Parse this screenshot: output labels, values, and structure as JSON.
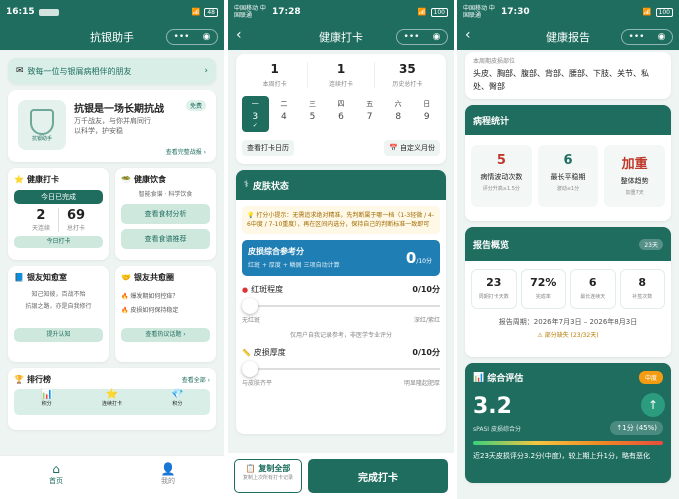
{
  "p1": {
    "status": {
      "time": "16:15",
      "carrier": "中国移动 中国联通",
      "battery": "48"
    },
    "nav_title": "抗银助手",
    "banner": "致每一位与银屑病相伴的朋友",
    "hero": {
      "title": "抗银是一场长期抗战",
      "badge": "免费",
      "l1": "万千战友，与你并肩同行",
      "l2": "以科学，护安稳",
      "shield": "抗银助手",
      "link": "查看完整战报 ›"
    },
    "checkin": {
      "title": "健康打卡",
      "done": "今日已完成",
      "days": "2",
      "days_l": "天连续",
      "count": "69",
      "count_l": "总打卡",
      "btn": "今日打卡"
    },
    "diet": {
      "title": "健康饮食",
      "sub": "智能食谱 · 科学饮食",
      "b1": "查看食材分析",
      "b2": "查看食谱推荐"
    },
    "knowledge": {
      "title": "银友知愈室",
      "t1": "知己知彼，百战不殆",
      "t2": "抗银之路，亦是自我修行",
      "btn": "提升认知"
    },
    "community": {
      "title": "银友共愈圈",
      "i1": "爆发期如何控痒？",
      "i2": "皮损如何保持稳定",
      "btn": "查看热议话题 ›"
    },
    "rank": {
      "title": "排行榜",
      "link": "查看全部 ›",
      "tabs": [
        "积分",
        "连续打卡",
        "积分"
      ]
    },
    "tabbar": {
      "home": "首页",
      "me": "我的"
    }
  },
  "p2": {
    "status": {
      "time": "17:28",
      "carrier": "中国移动 中国联通",
      "battery": "100"
    },
    "nav_title": "健康打卡",
    "stats": [
      {
        "v": "1",
        "l": "本周打卡"
      },
      {
        "v": "1",
        "l": "连续打卡"
      },
      {
        "v": "35",
        "l": "历史总打卡"
      }
    ],
    "week": [
      {
        "d": "一",
        "n": "3",
        "sel": true
      },
      {
        "d": "二",
        "n": "4"
      },
      {
        "d": "三",
        "n": "5"
      },
      {
        "d": "四",
        "n": "6"
      },
      {
        "d": "五",
        "n": "7"
      },
      {
        "d": "六",
        "n": "8"
      },
      {
        "d": "日",
        "n": "9"
      }
    ],
    "cal_btn": "查看打卡日历",
    "cycle_btn": "自定义月份",
    "skin_title": "皮肤状态",
    "tip": "打分小提示：无需追求绝对精准，先判断属于哪一档（1-3轻微 / 4-6中度 / 7-10重度），再在区间内选分，保持自己的判断标准一致即可",
    "score": {
      "title": "皮损综合参考分",
      "sub": "红斑 + 厚度 + 鳞屑 三项自动计算",
      "v": "0",
      "u": "/10分"
    },
    "s1": {
      "t": "红斑程度",
      "v": "0/10分",
      "lo": "无红斑",
      "hi": "深红/紫红"
    },
    "note": "仅用户自我记录参考，非医学专业评分",
    "s2": {
      "t": "皮损厚度",
      "v": "0/10分",
      "lo": "与皮肤齐平",
      "hi": "明显隆起肥厚"
    },
    "copy": {
      "t": "复制全部",
      "s": "复制上次所有打卡记录"
    },
    "submit": "完成打卡"
  },
  "p3": {
    "status": {
      "time": "17:30",
      "carrier": "中国移动 中国联通",
      "battery": "100"
    },
    "nav_title": "健康报告",
    "parts_head": "本周期皮损部位",
    "parts": "头皮、胸部、腹部、背部、腰部、下肢、关节、私处、臀部",
    "course": {
      "title": "病程统计",
      "items": [
        {
          "v": "5",
          "l": "病情波动次数",
          "s": "评分升高≥1.5分"
        },
        {
          "v": "6",
          "l": "最长平稳期",
          "s": "波动≤1分"
        },
        {
          "v": "加重",
          "l": "整体趋势",
          "s": "加重7天"
        }
      ]
    },
    "overview": {
      "title": "报告概览",
      "badge": "23天",
      "items": [
        {
          "v": "23",
          "l": "周期打卡天数"
        },
        {
          "v": "72%",
          "l": "完成率"
        },
        {
          "v": "6",
          "l": "最长连续天"
        },
        {
          "v": "8",
          "l": "补签次数"
        }
      ],
      "period": "报告周期：2026年7月3日 – 2026年8月3日",
      "missing": "部分缺失 (23/32天)"
    },
    "eval": {
      "title": "综合评估",
      "badge": "中度",
      "score": "3.2",
      "sub": "sPASI 皮损综合分",
      "delta": "↑1分 (45%)",
      "text": "近23天皮损评分3.2分(中度)，较上期上升1分，略有恶化"
    }
  }
}
